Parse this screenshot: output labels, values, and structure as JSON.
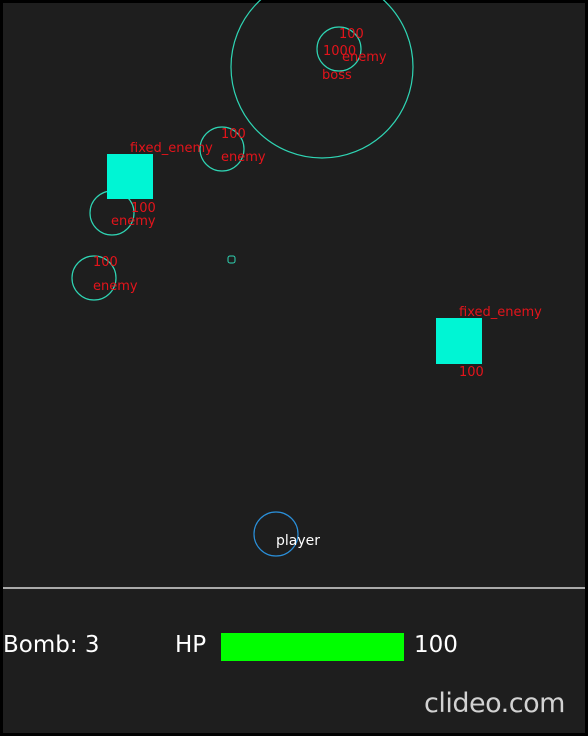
{
  "colors": {
    "frame": "#000000",
    "field": "#1e1e1e",
    "divider": "#d9d9d9",
    "entity_outline": "#2fd5b4",
    "fixed_enemy_fill": "#00f5d4",
    "player_outline": "#2a8fd9",
    "label_red": "#e4141b",
    "label_white": "#ffffff",
    "hp_fill": "#00ff00",
    "watermark": "#d2d2d2"
  },
  "boss": {
    "hp": "1000",
    "name": "boss"
  },
  "enemies": [
    {
      "hp": "100",
      "name": "enemy"
    },
    {
      "hp": "100",
      "name": "enemy"
    },
    {
      "hp": "100",
      "name": "enemy"
    },
    {
      "hp": "100",
      "name": "enemy"
    }
  ],
  "fixed_enemies": [
    {
      "name": "fixed_enemy",
      "hp": ""
    },
    {
      "name": "fixed_enemy",
      "hp": "100"
    }
  ],
  "player": {
    "name": "player"
  },
  "hud": {
    "bomb_text": "Bomb: 3",
    "hp_label": "HP",
    "hp_value": "100",
    "hp_fraction": 1.0
  },
  "watermark": "clideo.com"
}
